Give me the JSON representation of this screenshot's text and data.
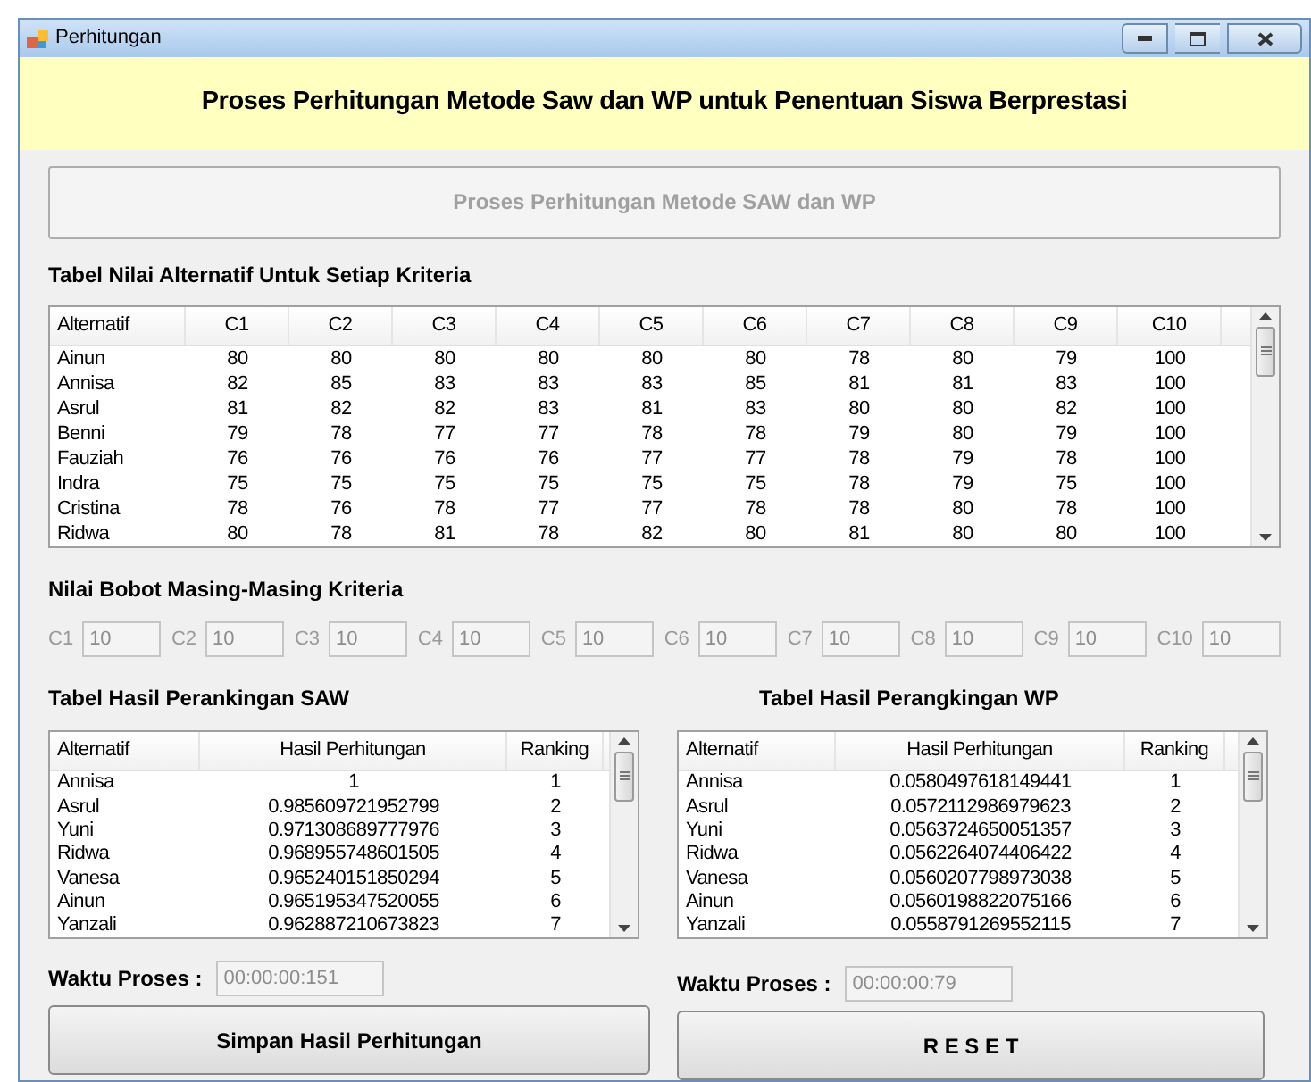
{
  "window": {
    "title": "Perhitungan"
  },
  "header": {
    "title": "Proses Perhitungan Metode Saw dan WP untuk Penentuan Siswa Berprestasi"
  },
  "process_button": {
    "label": "Proses Perhitungan Metode SAW dan WP",
    "disabled": true
  },
  "values_table": {
    "title": "Tabel Nilai Alternatif Untuk Setiap Kriteria",
    "columns": [
      "Alternatif",
      "C1",
      "C2",
      "C3",
      "C4",
      "C5",
      "C6",
      "C7",
      "C8",
      "C9",
      "C10"
    ],
    "rows": [
      [
        "Ainun",
        "80",
        "80",
        "80",
        "80",
        "80",
        "80",
        "78",
        "80",
        "79",
        "100"
      ],
      [
        "Annisa",
        "82",
        "85",
        "83",
        "83",
        "83",
        "85",
        "81",
        "81",
        "83",
        "100"
      ],
      [
        "Asrul",
        "81",
        "82",
        "82",
        "83",
        "81",
        "83",
        "80",
        "80",
        "82",
        "100"
      ],
      [
        "Benni",
        "79",
        "78",
        "77",
        "77",
        "78",
        "78",
        "79",
        "80",
        "79",
        "100"
      ],
      [
        "Fauziah",
        "76",
        "76",
        "76",
        "76",
        "77",
        "77",
        "78",
        "79",
        "78",
        "100"
      ],
      [
        "Indra",
        "75",
        "75",
        "75",
        "75",
        "75",
        "75",
        "78",
        "79",
        "75",
        "100"
      ],
      [
        "Cristina",
        "78",
        "76",
        "78",
        "77",
        "77",
        "78",
        "78",
        "80",
        "78",
        "100"
      ],
      [
        "Ridwa",
        "80",
        "78",
        "81",
        "78",
        "82",
        "80",
        "81",
        "80",
        "80",
        "100"
      ]
    ]
  },
  "weights": {
    "title": "Nilai Bobot Masing-Masing Kriteria",
    "fields": [
      {
        "label": "C1",
        "value": "10",
        "disabled": true
      },
      {
        "label": "C2",
        "value": "10",
        "disabled": true
      },
      {
        "label": "C3",
        "value": "10",
        "disabled": true
      },
      {
        "label": "C4",
        "value": "10",
        "disabled": true
      },
      {
        "label": "C5",
        "value": "10",
        "disabled": true
      },
      {
        "label": "C6",
        "value": "10",
        "disabled": true
      },
      {
        "label": "C7",
        "value": "10",
        "disabled": true
      },
      {
        "label": "C8",
        "value": "10",
        "disabled": true
      },
      {
        "label": "C9",
        "value": "10",
        "disabled": true
      },
      {
        "label": "C10",
        "value": "10",
        "disabled": true
      }
    ]
  },
  "results": [
    {
      "title": "Tabel Hasil Perankingan SAW",
      "columns": [
        "Alternatif",
        "Hasil Perhitungan",
        "Ranking"
      ],
      "rows": [
        [
          "Annisa",
          "1",
          "1"
        ],
        [
          "Asrul",
          "0.985609721952799",
          "2"
        ],
        [
          "Yuni",
          "0.971308689777976",
          "3"
        ],
        [
          "Ridwa",
          "0.968955748601505",
          "4"
        ],
        [
          "Vanesa",
          "0.965240151850294",
          "5"
        ],
        [
          "Ainun",
          "0.965195347520055",
          "6"
        ],
        [
          "Yanzali",
          "0.962887210673823",
          "7"
        ]
      ],
      "time_label": "Waktu Proses :",
      "time": {
        "value": "00:00:00:151",
        "disabled": true
      },
      "button": {
        "label": "Simpan Hasil Perhitungan"
      }
    },
    {
      "title": "Tabel Hasil Perangkingan WP",
      "columns": [
        "Alternatif",
        "Hasil Perhitungan",
        "Ranking"
      ],
      "rows": [
        [
          "Annisa",
          "0.0580497618149441",
          "1"
        ],
        [
          "Asrul",
          "0.0572112986979623",
          "2"
        ],
        [
          "Yuni",
          "0.0563724650051357",
          "3"
        ],
        [
          "Ridwa",
          "0.0562264074406422",
          "4"
        ],
        [
          "Vanesa",
          "0.0560207798973038",
          "5"
        ],
        [
          "Ainun",
          "0.0560198822075166",
          "6"
        ],
        [
          "Yanzali",
          "0.0558791269552115",
          "7"
        ]
      ],
      "time_label": "Waktu Proses :",
      "time": {
        "value": "00:00:00:79",
        "disabled": true
      },
      "button": {
        "label": "R E S E T"
      }
    }
  ]
}
